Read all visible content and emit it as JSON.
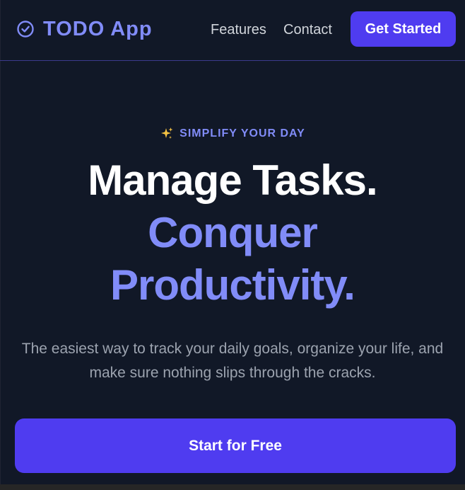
{
  "nav": {
    "brand": "TODO App",
    "brand_icon": "check-circle-icon",
    "links": [
      "Features",
      "Contact"
    ],
    "cta_label": "Get Started"
  },
  "hero": {
    "eyebrow_icon": "sparkles-icon",
    "eyebrow": "SIMPLIFY YOUR DAY",
    "headline_line1": "Manage Tasks.",
    "headline_line2": "Conquer",
    "headline_line3": "Productivity.",
    "subtext": "The easiest way to track your daily goals, organize your life, and make sure nothing slips through the cracks.",
    "cta_label": "Start for Free"
  },
  "colors": {
    "background": "#111827",
    "accent": "#818cf8",
    "button": "#4f3cf0",
    "muted_text": "#9ca3af",
    "nav_text": "#d1d5db"
  }
}
